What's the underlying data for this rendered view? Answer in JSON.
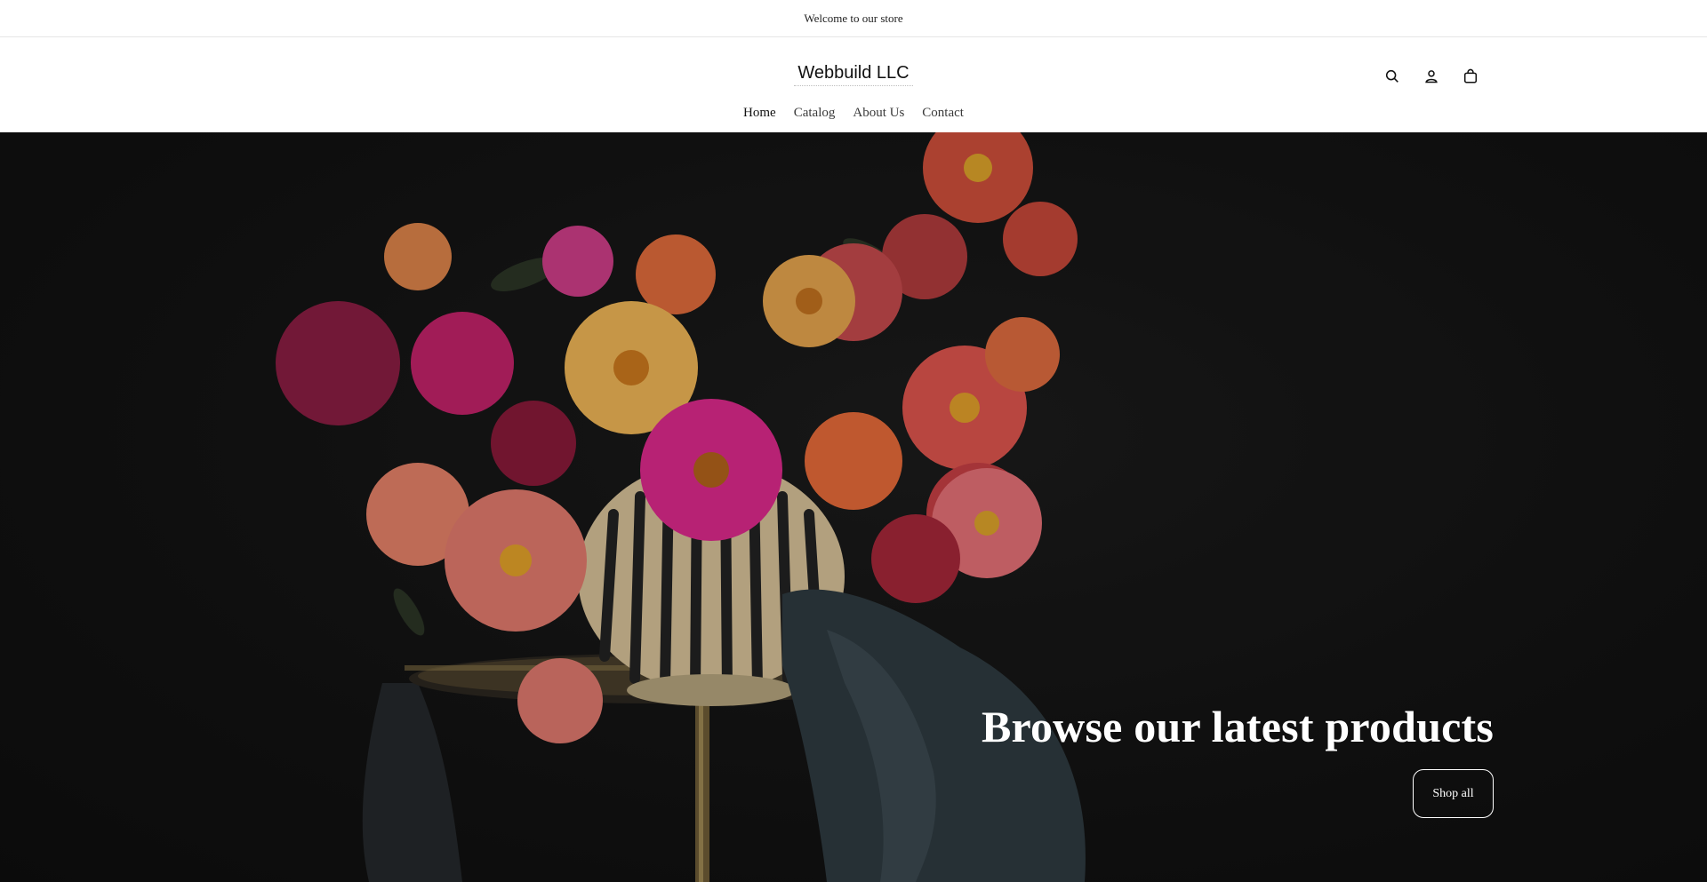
{
  "announcement": {
    "text": "Welcome to our store"
  },
  "header": {
    "logo": "Webbuild LLC",
    "nav": [
      {
        "label": "Home",
        "active": true
      },
      {
        "label": "Catalog",
        "active": false
      },
      {
        "label": "About Us",
        "active": false
      },
      {
        "label": "Contact",
        "active": false
      }
    ],
    "icons": [
      "search-icon",
      "account-icon",
      "cart-icon"
    ]
  },
  "hero": {
    "title": "Browse our latest products",
    "button_label": "Shop all",
    "image_subject": "flowers-in-striped-vase"
  },
  "colors": {
    "hero_background": "#141414",
    "text": "#121212",
    "white": "#ffffff"
  }
}
